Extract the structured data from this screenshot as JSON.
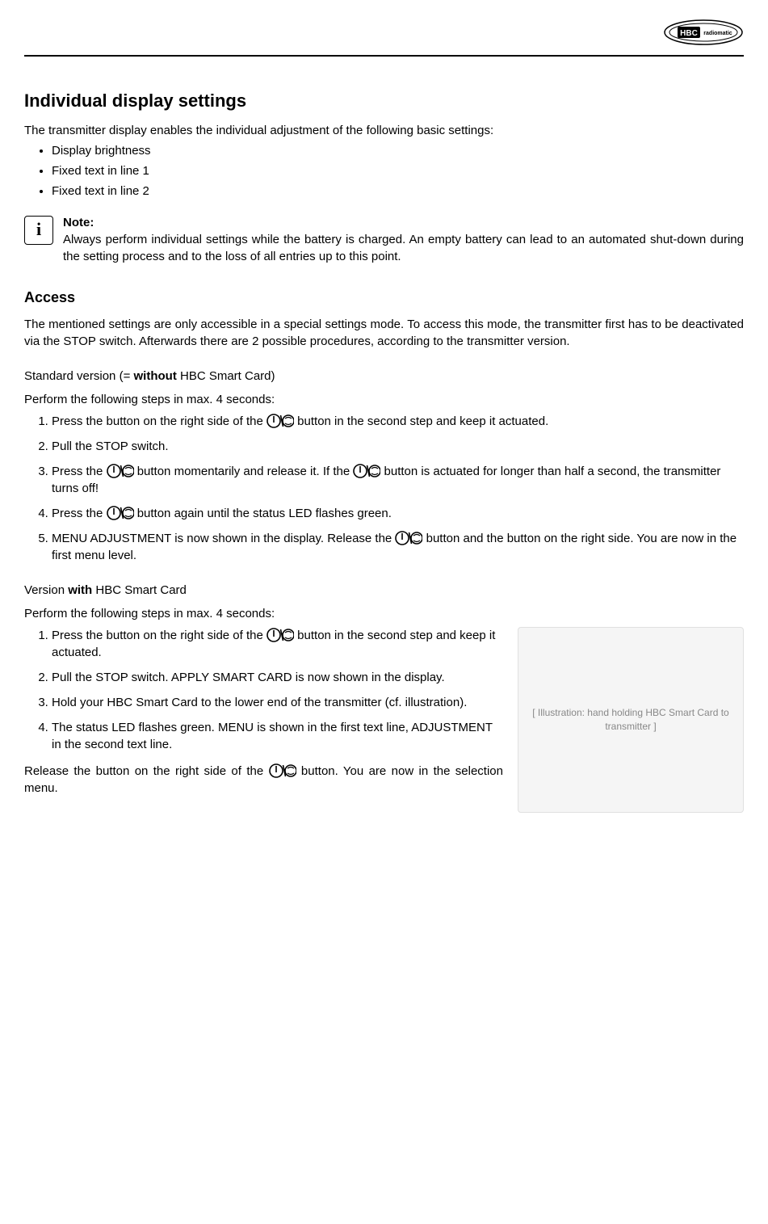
{
  "header": {
    "logo_alt": "HBC radiomatic"
  },
  "title": "Individual display settings",
  "intro": {
    "lead": "The transmitter display enables the individual adjustment of the following basic settings:",
    "bullets": [
      "Display brightness",
      "Fixed text in line 1",
      "Fixed text in line 2"
    ]
  },
  "note": {
    "title": "Note:",
    "body": "Always perform individual settings while the battery is charged. An empty battery can lead to an automated shut-down during the setting process and to the loss of all entries up to this point."
  },
  "access": {
    "heading": "Access",
    "intro": "The mentioned settings are only accessible in a special settings mode. To access this mode, the transmitter first has to be deactivated via the STOP switch. Afterwards there are 2 possible procedures, according to the transmitter version."
  },
  "standard": {
    "label_pre": "Standard version (= ",
    "label_bold": "without",
    "label_post": " HBC Smart Card)",
    "lead": "Perform the following steps in max. 4 seconds:",
    "steps": {
      "s1a": "Press the button on the right side of the ",
      "s1b": " button in the second step and keep it actuated.",
      "s2": "Pull the STOP switch.",
      "s3a": "Press the ",
      "s3b": " button momentarily and release it. If the ",
      "s3c": " button is actuated for longer than half a second, the transmitter turns off!",
      "s4a": "Press the ",
      "s4b": " button again until the status LED flashes green.",
      "s5a": "MENU ADJUSTMENT is now shown in the display. Release the ",
      "s5b": " button and the button on the right side. You are now in the first menu level."
    }
  },
  "smart": {
    "label_pre": "Version ",
    "label_bold": "with",
    "label_post": " HBC Smart Card",
    "lead": "Perform the following steps in max. 4 seconds:",
    "steps": {
      "s1a": "Press the button on the right side of the ",
      "s1b": " button in the second step and keep it actuated.",
      "s2": "Pull the STOP switch. APPLY SMART CARD is now shown in the display.",
      "s3": "Hold your HBC Smart Card to the lower end of the transmitter (cf. illustration).",
      "s4": "The status LED flashes green. MENU is shown in the first text line, ADJUSTMENT in the second text line."
    },
    "after_a": "Release the button on the right side of the ",
    "after_b": " button. You are now in the selection menu.",
    "image_placeholder": "[ Illustration: hand holding HBC Smart Card to transmitter ]"
  }
}
